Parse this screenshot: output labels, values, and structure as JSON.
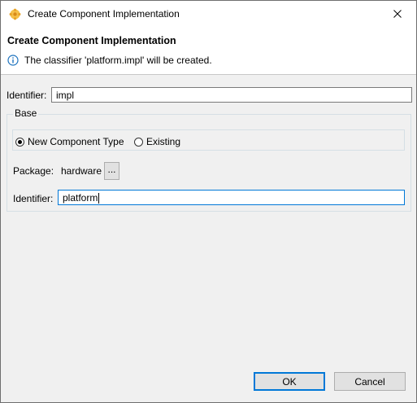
{
  "window": {
    "title": "Create Component Implementation",
    "close_icon": "close-icon"
  },
  "header": {
    "heading": "Create Component Implementation",
    "message": "The classifier 'platform.impl' will be created."
  },
  "form": {
    "identifier_label": "Identifier:",
    "identifier_value": "impl",
    "base": {
      "group_label": "Base",
      "radio_new_label": "New Component Type",
      "radio_existing_label": "Existing",
      "selected": "New Component Type",
      "package_label": "Package:",
      "package_value": "hardware",
      "browse_label": "...",
      "identifier_label": "Identifier:",
      "identifier_value": "platform"
    }
  },
  "buttons": {
    "ok_label": "OK",
    "cancel_label": "Cancel"
  },
  "colors": {
    "accent": "#0078d7",
    "info_icon": "#1e73be",
    "app_icon": "#f0a830"
  }
}
